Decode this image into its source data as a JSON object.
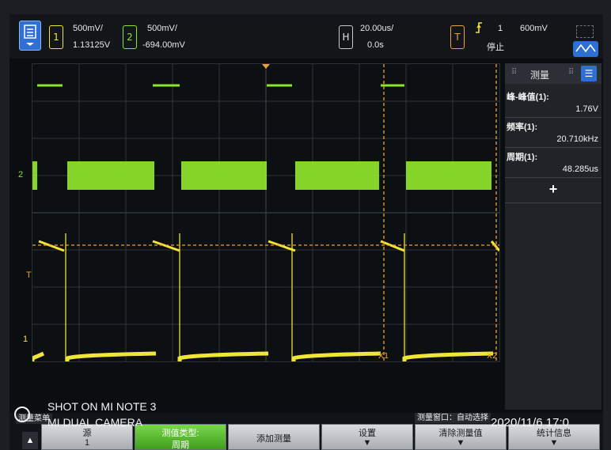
{
  "topbar": {
    "menu_icon": "menu-icon",
    "ch1": {
      "num": "1",
      "scale": "500mV/",
      "offset": "1.13125V"
    },
    "ch2": {
      "num": "2",
      "scale": "500mV/",
      "offset": "-694.00mV"
    },
    "horizontal": {
      "key": "H",
      "scale": "20.00us/",
      "delay": "0.0s"
    },
    "trigger": {
      "key": "T",
      "edge_icon": "rising-edge-icon",
      "source": "1",
      "level": "600mV",
      "status": "停止"
    },
    "run_icon": "waveform-icon"
  },
  "plot": {
    "ch1_marker": "1",
    "ch2_marker": "2",
    "trigger_marker": "T",
    "cursor_x1": "X1",
    "cursor_x2": "X2"
  },
  "measure_panel": {
    "title": "测量",
    "items": [
      {
        "label": "峰-峰值(1):",
        "value": "1.76V"
      },
      {
        "label": "频率(1):",
        "value": "20.710kHz"
      },
      {
        "label": "周期(1):",
        "value": "48.285us"
      }
    ],
    "add_icon": "plus-icon"
  },
  "softkeys": {
    "menu_title": "测量菜单",
    "window_title": "测量窗口：自动选择",
    "keys": [
      {
        "top": "源",
        "bottom": "1"
      },
      {
        "top": "测值类型:",
        "bottom": "周期"
      },
      {
        "top": "添加测量",
        "bottom": ""
      },
      {
        "top": "设置",
        "bottom": "▼"
      },
      {
        "top": "清除测量值",
        "bottom": "▼"
      },
      {
        "top": "统计信息",
        "bottom": "▼"
      }
    ]
  },
  "overlay": {
    "camera1": "SHOT ON MI NOTE 3",
    "camera2": "MI DUAL CAMERA",
    "datetime": "2020/11/6  17:0"
  },
  "colors": {
    "ch1": "#f2e53a",
    "ch2": "#8ee62a",
    "cursor": "#f0a030",
    "accent": "#3b78d8"
  }
}
